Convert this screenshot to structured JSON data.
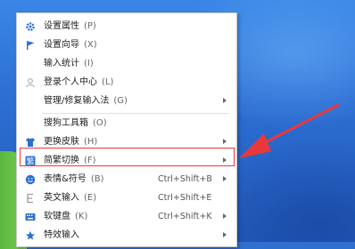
{
  "colors": {
    "accent_icon": "#2b6fd1",
    "highlight_border": "#e8383b",
    "annotation_arrow": "#e8383b",
    "desktop_blue": "#2f6fd0"
  },
  "menu": {
    "items": [
      {
        "label": "设置属性",
        "key": "(P)",
        "icon": "gear-icon",
        "shortcut": "",
        "submenu": false
      },
      {
        "label": "设置向导",
        "key": "(X)",
        "icon": "flag-icon",
        "shortcut": "",
        "submenu": false
      },
      {
        "label": "输入统计",
        "key": "(I)",
        "icon": "",
        "shortcut": "",
        "submenu": false
      },
      {
        "label": "登录个人中心",
        "key": "(L)",
        "icon": "user-icon",
        "shortcut": "",
        "submenu": false
      },
      {
        "label": "管理/修复输入法",
        "key": "(G)",
        "icon": "",
        "shortcut": "",
        "submenu": true
      },
      {
        "label": "搜狗工具箱",
        "key": "(O)",
        "icon": "",
        "shortcut": "",
        "submenu": false
      },
      {
        "label": "更换皮肤",
        "key": "(H)",
        "icon": "shirt-icon",
        "shortcut": "",
        "submenu": true
      },
      {
        "label": "简繁切换",
        "key": "(F)",
        "icon": "simp-trad-icon",
        "shortcut": "",
        "submenu": true
      },
      {
        "label": "表情&符号",
        "key": "(B)",
        "icon": "smiley-icon",
        "shortcut": "Ctrl+Shift+B",
        "submenu": true
      },
      {
        "label": "英文输入",
        "key": "(E)",
        "icon": "english-icon",
        "shortcut": "Ctrl+Shift+E",
        "submenu": false
      },
      {
        "label": "软键盘",
        "key": "(K)",
        "icon": "keyboard-icon",
        "shortcut": "Ctrl+Shift+K",
        "submenu": true
      },
      {
        "label": "特效输入",
        "key": "",
        "icon": "effects-icon",
        "shortcut": "",
        "submenu": true
      }
    ],
    "highlighted_item": "简繁切换"
  }
}
